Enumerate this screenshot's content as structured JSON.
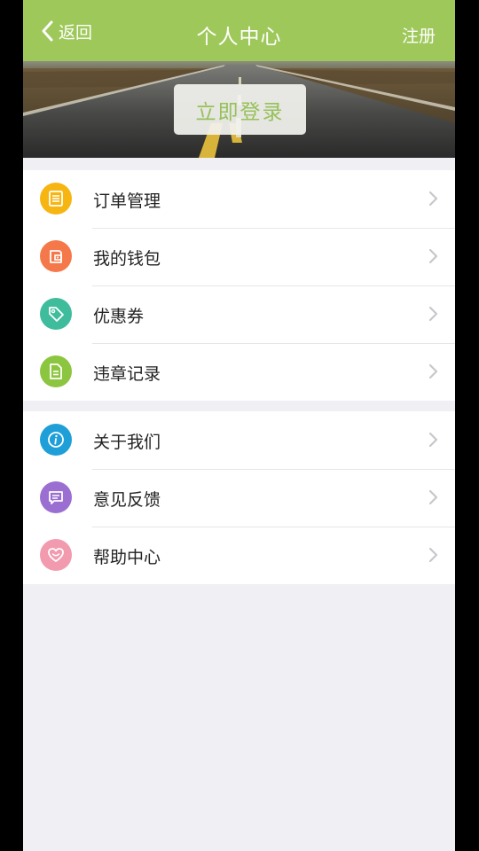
{
  "header": {
    "back_label": "返回",
    "title": "个人中心",
    "register_label": "注册",
    "background_color": "#9ec85a"
  },
  "banner": {
    "login_button_label": "立即登录",
    "login_text_color": "#97c15a"
  },
  "menu_group_1": [
    {
      "label": "订单管理",
      "icon": "order-list-icon",
      "color": "#f7b512"
    },
    {
      "label": "我的钱包",
      "icon": "wallet-icon",
      "color": "#f5784a"
    },
    {
      "label": "优惠券",
      "icon": "coupon-tag-icon",
      "color": "#3fbc9b"
    },
    {
      "label": "违章记录",
      "icon": "violation-document-icon",
      "color": "#8cc53f"
    }
  ],
  "menu_group_2": [
    {
      "label": "关于我们",
      "icon": "info-icon",
      "color": "#1e9fd8"
    },
    {
      "label": "意见反馈",
      "icon": "feedback-message-icon",
      "color": "#9b6fd1"
    },
    {
      "label": "帮助中心",
      "icon": "help-heart-icon",
      "color": "#f29aae"
    }
  ]
}
